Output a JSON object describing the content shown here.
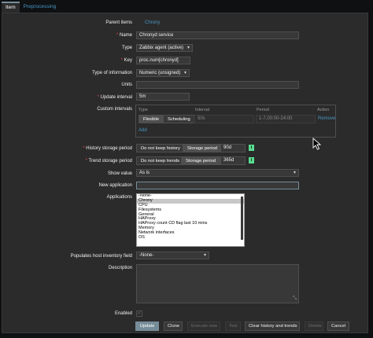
{
  "tabs": [
    {
      "label": "Item"
    },
    {
      "label": "Preprocessing"
    }
  ],
  "form": {
    "parent_items_label": "Parent items",
    "parent_items_value": "Chrony",
    "name_label": "Name",
    "name_value": "Chronyd service",
    "type_label": "Type",
    "type_value": "Zabbix agent (active)",
    "key_label": "Key",
    "key_value": "proc.num[chronyd]",
    "type_info_label": "Type of information",
    "type_info_value": "Numeric (unsigned)",
    "units_label": "Units",
    "units_value": "",
    "update_interval_label": "Update interval",
    "update_interval_value": "5m",
    "custom_intervals": {
      "label": "Custom intervals",
      "headers": [
        "Type",
        "Interval",
        "Period",
        "Action"
      ],
      "row": {
        "flexible": "Flexible",
        "scheduling": "Scheduling",
        "interval": "50s",
        "period": "1-7,00:00-24:00",
        "remove": "Remove"
      },
      "add": "Add"
    },
    "history_label": "History storage period",
    "history_opt1": "Do not keep history",
    "history_opt2": "Storage period",
    "history_value": "90d",
    "trend_label": "Trend storage period",
    "trend_opt1": "Do not keep trends",
    "trend_opt2": "Storage period",
    "trend_value": "365d",
    "info_mark": "i",
    "required_mark": "*",
    "show_value_label": "Show value",
    "show_value_value": "As is",
    "new_app_label": "New application",
    "new_app_value": "",
    "applications_label": "Applications",
    "applications": [
      "-None-",
      "Chrony",
      "CPU",
      "Filesystems",
      "General",
      "HAProxy",
      "HAProxy count CD flag last 10 mins",
      "Memory",
      "Network interfaces",
      "OS"
    ],
    "inventory_label": "Populates host inventory field",
    "inventory_value": "-None-",
    "description_label": "Description",
    "enabled_label": "Enabled",
    "enabled_check": "✓"
  },
  "buttons": {
    "update": "Update",
    "clone": "Clone",
    "execute_now": "Execute now",
    "test": "Test",
    "clear_history": "Clear history and trends",
    "delete": "Delete",
    "cancel": "Cancel"
  },
  "colors": {
    "background": "#0e1012",
    "panel": "#2b2b2b",
    "accent": "#768d99",
    "link": "#4796c4",
    "required": "#e54251",
    "info": "#59db8f"
  }
}
